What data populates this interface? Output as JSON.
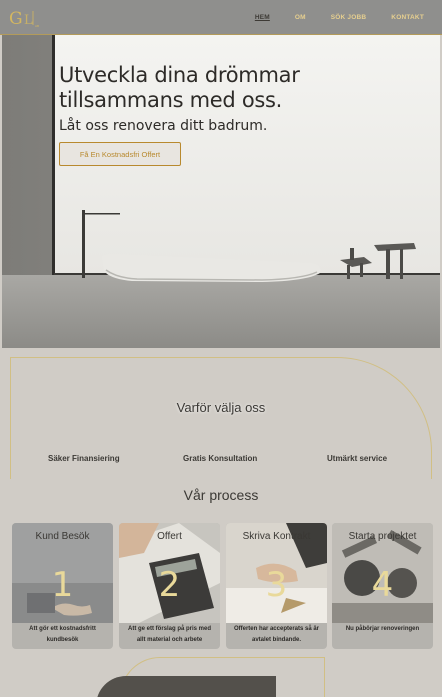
{
  "header": {
    "logo_icon": "gl-monogram-logo",
    "nav": [
      {
        "label": "HEM",
        "active": true
      },
      {
        "label": "OM",
        "active": false
      },
      {
        "label": "SÖK JOBB",
        "active": false
      },
      {
        "label": "KONTAKT",
        "active": false
      }
    ]
  },
  "hero": {
    "title": "Utveckla dina drömmar tillsammans med oss.",
    "subtitle": "Låt oss renovera ditt badrum.",
    "cta": "Få En Kostnadsfri Offert"
  },
  "why": {
    "title": "Varför välja oss",
    "features": [
      "Säker Finansiering",
      "Gratis Konsultation",
      "Utmärkt service"
    ]
  },
  "process": {
    "title": "Vår process",
    "steps": [
      {
        "title": "Kund Besök",
        "number": "1",
        "desc": "Att gör ett kostnadsfritt kundbesök"
      },
      {
        "title": "Offert",
        "number": "2",
        "desc": "Att ge ett förslag på pris med allt material och arbete"
      },
      {
        "title": "Skriva Kontrakt",
        "number": "3",
        "desc": "Offerten har accepterats så är avtalet bindande."
      },
      {
        "title": "Starta projektet",
        "number": "4",
        "desc": "Nu påbörjar renoveringen"
      }
    ]
  },
  "colors": {
    "accent_gold": "#b8892e",
    "header_bg": "#8f8f8d",
    "page_bg": "#d0ccc6"
  }
}
